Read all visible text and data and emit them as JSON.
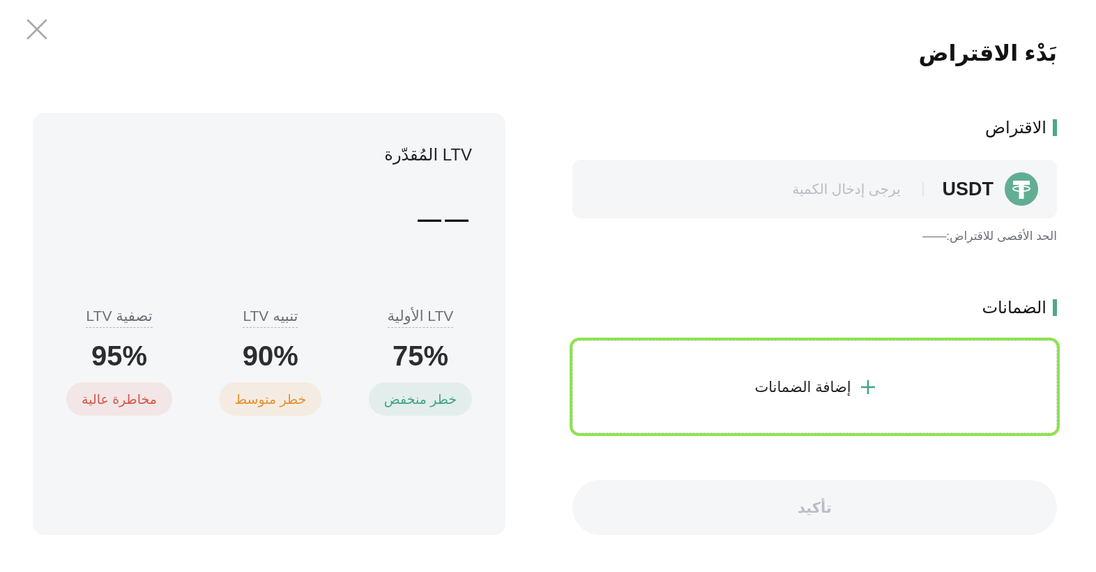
{
  "title": "بَدْء الاقتراض",
  "ltv_panel": {
    "label": "LTV المُقدّرة",
    "value": "——",
    "levels": [
      {
        "label": "LTV الأولية",
        "value": "75%",
        "risk": "خطر منخفض",
        "color": "#42a487"
      },
      {
        "label": "تنبيه LTV",
        "value": "90%",
        "risk": "خطر متوسط",
        "color": "#e8912d"
      },
      {
        "label": "تصفية LTV",
        "value": "95%",
        "risk": "مخاطرة عالية",
        "color": "#d4574a"
      }
    ]
  },
  "borrow": {
    "heading": "الاقتراض",
    "currency": "USDT",
    "placeholder": "يرجى إدخال الكمية",
    "max_label": "الحد الأقصى للاقتراض:——"
  },
  "collateral": {
    "heading": "الضمانات",
    "add_button": {
      "label": "إضافة الضمانات",
      "highlighted": true
    }
  },
  "confirm_button": {
    "label": "تأكيد",
    "disabled": true
  }
}
